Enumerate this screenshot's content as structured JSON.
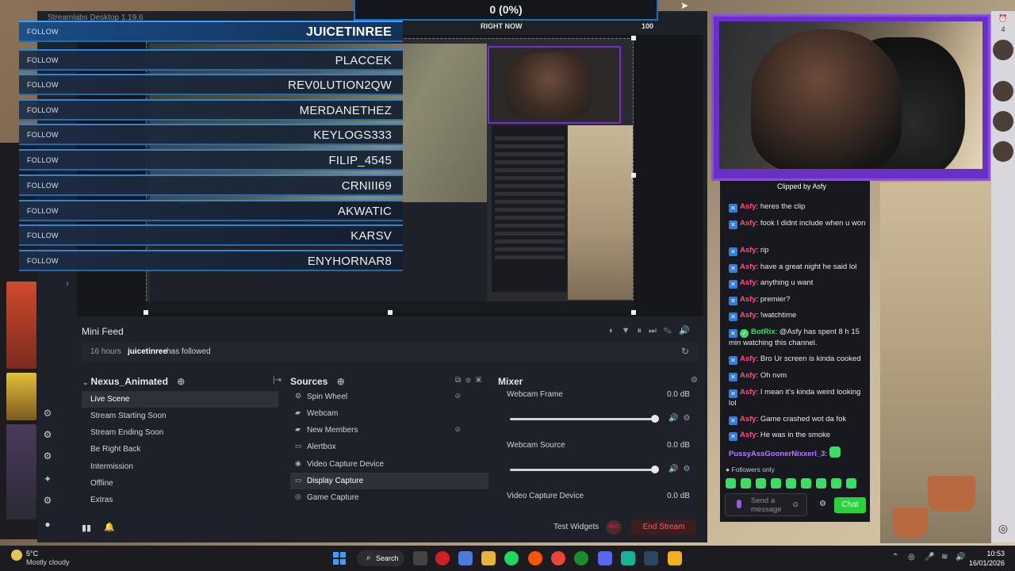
{
  "window": {
    "title": "Streamlabs Desktop 1.19.6"
  },
  "goal": {
    "value": "0 (0%)",
    "left_label": "RIGHT NOW",
    "right_label": "100"
  },
  "followers": {
    "follow_label": "FOLLOW",
    "names": [
      "JUICETINREE",
      "PLACCEK",
      "REV0LUTION2QW",
      "MERDANETHEZ",
      "KEYLOGS333",
      "FILIP_4545",
      "CRNIII69",
      "AKWATIC",
      "KARSV",
      "ENYHORNAR8"
    ]
  },
  "mini_feed": {
    "title": "Mini Feed",
    "time": "16 hours",
    "user": "juicetinree",
    "event": "has followed"
  },
  "scenes": {
    "header": "Nexus_Animated",
    "items": [
      "Live Scene",
      "Stream Starting Soon",
      "Stream Ending Soon",
      "Be Right Back",
      "Intermission",
      "Offline",
      "Extras"
    ],
    "active_index": 0
  },
  "sources": {
    "header": "Sources",
    "items": [
      "Spin Wheel",
      "Webcam",
      "New Members",
      "Alertbox",
      "Video Capture Device",
      "Display Capture",
      "Game Capture"
    ],
    "active_index": 5
  },
  "mixer": {
    "header": "Mixer",
    "channels": [
      {
        "name": "Webcam Frame",
        "db": "0.0 dB",
        "level": 1.0
      },
      {
        "name": "Webcam Source",
        "db": "0.0 dB",
        "level": 1.0
      },
      {
        "name": "Video Capture Device",
        "db": "0.0 dB",
        "level": 1.0
      }
    ]
  },
  "footer": {
    "test_widgets": "Test Widgets",
    "rec": "REC",
    "end_stream": "End Stream"
  },
  "chat": {
    "clip": "Clipped by Asfy",
    "messages": [
      {
        "user": "Asfy",
        "text": ": heres the clip",
        "kind": "normal"
      },
      {
        "user": "Asfy",
        "text": ": fook I didnt include when u won",
        "kind": "normal"
      },
      {
        "user": "Asfy",
        "text": ": rip",
        "kind": "normal"
      },
      {
        "user": "Asfy",
        "text": ": have a great night he said lol",
        "kind": "normal"
      },
      {
        "user": "Asfy",
        "text": ": anything u want",
        "kind": "normal"
      },
      {
        "user": "Asfy",
        "text": ": premier?",
        "kind": "normal"
      },
      {
        "user": "Asfy",
        "text": ": !watchtime",
        "kind": "normal"
      },
      {
        "user": "BotRix",
        "text": ": @Asfy has spent 8 h 15 min watching this channel.",
        "kind": "bot"
      },
      {
        "user": "Asfy",
        "text": ": Bro Ur screen is kinda cooked",
        "kind": "normal"
      },
      {
        "user": "Asfy",
        "text": ": Oh nvm",
        "kind": "normal"
      },
      {
        "user": "Asfy",
        "text": ": I mean it's kinda weird looking lol",
        "kind": "normal"
      },
      {
        "user": "Asfy",
        "text": ": Game crashed wot da fok",
        "kind": "normal"
      },
      {
        "user": "Asfy",
        "text": ": He was in the smoke",
        "kind": "normal"
      },
      {
        "user": "PussyAssGoonerNixxerl_3",
        "text": ":",
        "kind": "purple"
      }
    ],
    "followers_only": "Followers only",
    "send_placeholder_1": "Send a",
    "send_placeholder_2": "message",
    "chat_button": "Chat"
  },
  "taskbar": {
    "temp": "5°C",
    "weather": "Mostly cloudy",
    "search": "Search",
    "time": "10:53",
    "date": "16/01/2026"
  },
  "right_strip": {
    "count": "4"
  },
  "colors": {
    "accent_blue": "#2b86d9",
    "alert_purple": "#7b2bd3",
    "chat_green": "#25d33a",
    "end_red": "#ff5a5a"
  }
}
